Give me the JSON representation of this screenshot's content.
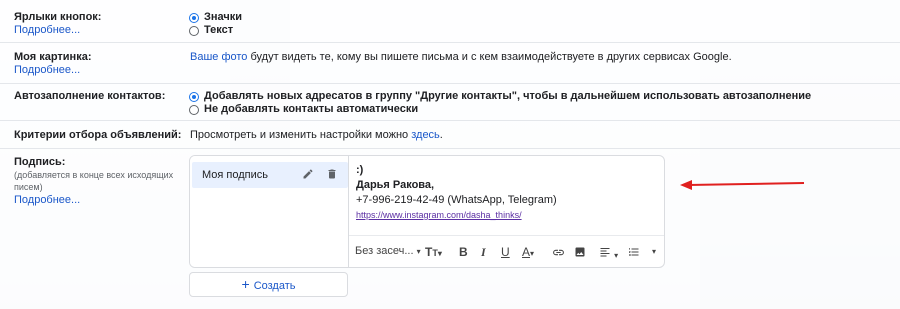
{
  "rows": {
    "button_labels": {
      "label": "Ярлыки кнопок:",
      "more": "Подробнее...",
      "options": [
        "Значки",
        "Текст"
      ],
      "selected": 0
    },
    "my_picture": {
      "label": "Моя картинка:",
      "more": "Подробнее...",
      "link": "Ваше фото",
      "text": " будут видеть те, кому вы пишете письма и с кем взаимодействуете в других сервисах Google."
    },
    "autocomplete": {
      "label": "Автозаполнение контактов:",
      "options": [
        "Добавлять новых адресатов в группу \"Другие контакты\", чтобы в дальнейшем использовать автозаполнение",
        "Не добавлять контакты автоматически"
      ],
      "selected": 0
    },
    "ads": {
      "label": "Критерии отбора объявлений:",
      "text": "Просмотреть и изменить настройки можно ",
      "link": "здесь",
      "tail": "."
    },
    "signature": {
      "label": "Подпись:",
      "sub": "(добавляется в конце всех исходящих писем)",
      "more": "Подробнее...",
      "item_name": "Моя подпись",
      "lines": [
        ":)",
        "Дарья Ракова,",
        "+7-996-219-42-49 (WhatsApp, Telegram)",
        "https://www.instagram.com/dasha_thinks/"
      ],
      "font_select": "Без засеч...",
      "create_label": "Создать",
      "create_icon": "+"
    }
  },
  "colors": {
    "accent": "#1a73e8",
    "link": "#1a57c9",
    "arrow": "#e0201f"
  },
  "icons": {
    "edit": "pencil-icon",
    "delete": "trash-icon",
    "text_size": "text-size-icon",
    "bold": "B",
    "italic": "I",
    "underline": "U",
    "text_color": "A"
  }
}
